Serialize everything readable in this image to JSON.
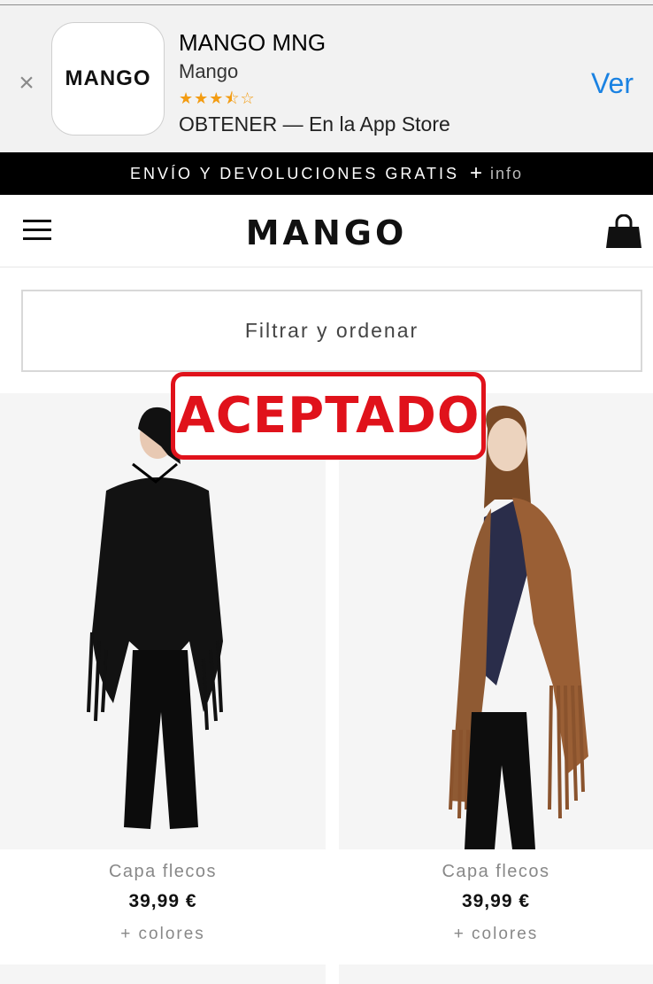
{
  "app_banner": {
    "close_icon": "close-icon",
    "icon_text": "MANGO",
    "app_name": "MANGO MNG",
    "developer": "Mango",
    "rating_stars": "★★★⯪☆",
    "get_text": "OBTENER — En la App Store",
    "view_label": "Ver",
    "view_color": "#1a82e2"
  },
  "promo_bar": {
    "text": "ENVÍO Y DEVOLUCIONES GRATIS",
    "plus": "+",
    "info": "info"
  },
  "nav": {
    "menu_icon": "hamburger-menu-icon",
    "logo": "MANGO",
    "bag_icon": "shopping-bag-icon"
  },
  "filter": {
    "label": "Filtrar y ordenar"
  },
  "stamp": {
    "text": "ACEPTADO",
    "color": "#e0121b"
  },
  "products": [
    {
      "name": "Capa flecos",
      "price": "39,99 €",
      "colors": "+ colores",
      "tone": "black"
    },
    {
      "name": "Capa flecos",
      "price": "39,99 €",
      "colors": "+ colores",
      "tone": "brown"
    }
  ]
}
